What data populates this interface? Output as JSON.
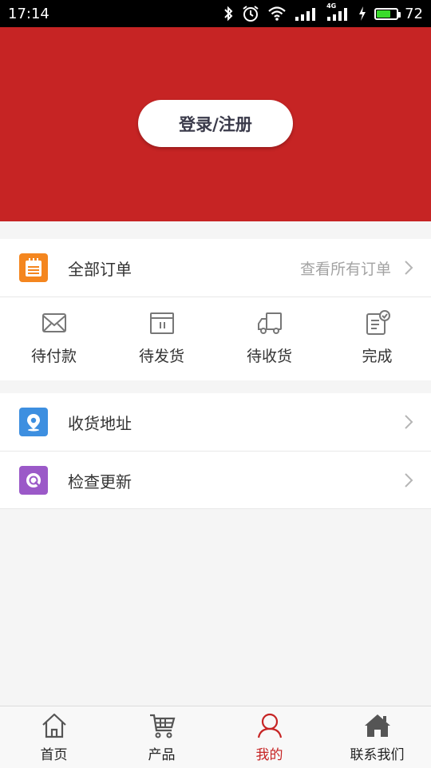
{
  "status_bar": {
    "time": "17:14",
    "battery_level": "72",
    "battery_fraction": 0.72,
    "network_label": "4G",
    "icons": [
      "bluetooth-icon",
      "alarm-icon",
      "wifi-icon",
      "signal-icon",
      "signal-4g-icon",
      "charging-icon",
      "battery-icon"
    ]
  },
  "header": {
    "login_label": "登录/注册",
    "background": "#c62424"
  },
  "orders": {
    "title": "全部订单",
    "view_all": "查看所有订单",
    "icon": "order-list-icon",
    "icon_color": "#f4861f",
    "statuses": [
      {
        "label": "待付款",
        "icon": "pending-payment-icon"
      },
      {
        "label": "待发货",
        "icon": "pending-shipment-icon"
      },
      {
        "label": "待收货",
        "icon": "pending-receipt-icon"
      },
      {
        "label": "完成",
        "icon": "completed-icon"
      }
    ]
  },
  "settings": {
    "items": [
      {
        "label": "收货地址",
        "icon": "location-icon",
        "icon_color": "#3d8fe0"
      },
      {
        "label": "检查更新",
        "icon": "update-icon",
        "icon_color": "#9b59c8"
      }
    ]
  },
  "bottom_nav": {
    "active": 2,
    "active_color": "#c62424",
    "items": [
      {
        "label": "首页",
        "icon": "home-outline-icon"
      },
      {
        "label": "产品",
        "icon": "cart-icon"
      },
      {
        "label": "我的",
        "icon": "user-icon"
      },
      {
        "label": "联系我们",
        "icon": "home-filled-icon"
      }
    ]
  }
}
